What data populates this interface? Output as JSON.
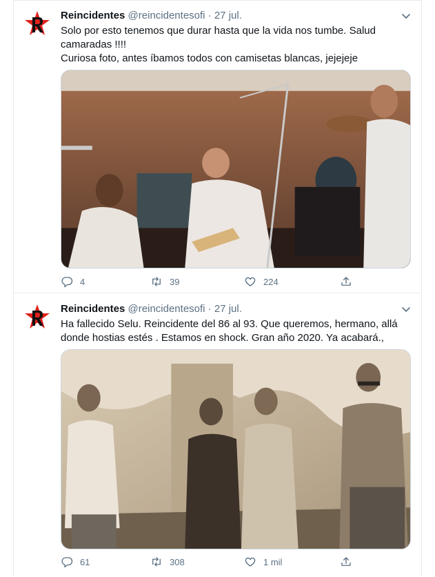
{
  "tweets": [
    {
      "name": "Reincidentes",
      "handle": "@reincidentesofi",
      "separator": "·",
      "date": "27 jul.",
      "text_lines": [
        "Solo por esto tenemos que durar hasta que la vida nos tumbe. Salud camaradas !!!!",
        "Curiosa foto, antes íbamos todos con camisetas blancas, jejejeje"
      ],
      "stats": {
        "replies": "4",
        "retweets": "39",
        "likes": "224"
      }
    },
    {
      "name": "Reincidentes",
      "handle": "@reincidentesofi",
      "separator": "·",
      "date": "27 jul.",
      "text_lines": [
        "Ha fallecido Selu. Reincidente del 86 al 93. Que queremos, hermano, allá donde hostias estés . Estamos en shock. Gran año 2020. Ya acabará.,"
      ],
      "stats": {
        "replies": "61",
        "retweets": "308",
        "likes": "1 mil"
      }
    }
  ],
  "icons": {
    "avatar": "reincidentes-star-logo",
    "caret": "chevron-down-icon",
    "reply": "reply-icon",
    "retweet": "retweet-icon",
    "like": "heart-icon",
    "share": "share-icon"
  },
  "colors": {
    "text": "#0f1419",
    "secondary": "#5b7083",
    "border": "#e6ecf0",
    "logo_red": "#e0201b"
  }
}
